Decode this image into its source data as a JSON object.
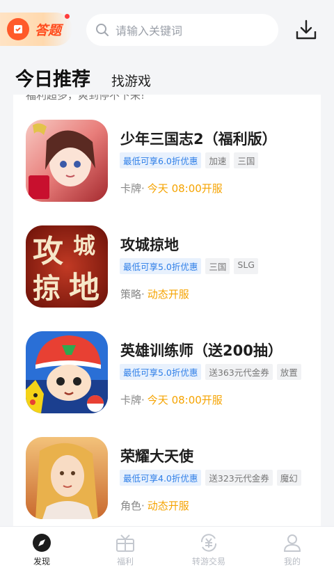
{
  "header": {
    "quiz_label": "答题",
    "search_placeholder": "请输入关键词",
    "tabs": [
      {
        "label": "今日推荐",
        "active": true
      },
      {
        "label": "找游戏",
        "active": false
      }
    ]
  },
  "notice": "福利超多，爽到停不下来!",
  "games": [
    {
      "title": "少年三国志2（福利版）",
      "tags": [
        {
          "text": "最低可享6.0折优惠",
          "style": "blue"
        },
        {
          "text": "加速",
          "style": "gray"
        },
        {
          "text": "三国",
          "style": "gray"
        }
      ],
      "category": "卡牌",
      "separator": "·",
      "open_time": "今天 08:00开服"
    },
    {
      "title": "攻城掠地",
      "tags": [
        {
          "text": "最低可享5.0折优惠",
          "style": "blue"
        },
        {
          "text": "三国",
          "style": "gray"
        },
        {
          "text": "SLG",
          "style": "gray"
        }
      ],
      "category": "策略",
      "separator": "·",
      "open_time": "动态开服",
      "icon_text": [
        "攻",
        "城",
        "掠",
        "地"
      ]
    },
    {
      "title": "英雄训练师（送200抽）",
      "tags": [
        {
          "text": "最低可享5.0折优惠",
          "style": "blue"
        },
        {
          "text": "送363元代金券",
          "style": "gray"
        },
        {
          "text": "放置",
          "style": "gray"
        }
      ],
      "category": "卡牌",
      "separator": "·",
      "open_time": "今天 08:00开服"
    },
    {
      "title": "荣耀大天使",
      "tags": [
        {
          "text": "最低可享4.0折优惠",
          "style": "blue"
        },
        {
          "text": "送323元代金券",
          "style": "gray"
        },
        {
          "text": "魔幻",
          "style": "gray"
        }
      ],
      "category": "角色",
      "separator": "·",
      "open_time": "动态开服"
    }
  ],
  "bottom_nav": [
    {
      "label": "发现",
      "icon": "compass-icon",
      "active": true
    },
    {
      "label": "福利",
      "icon": "gift-icon",
      "active": false
    },
    {
      "label": "转游交易",
      "icon": "exchange-icon",
      "active": false
    },
    {
      "label": "我的",
      "icon": "user-icon",
      "active": false
    }
  ],
  "colors": {
    "accent_blue": "#2f7fe8",
    "open_time_orange": "#f5a300",
    "quiz_orange": "#ff4c1e"
  }
}
